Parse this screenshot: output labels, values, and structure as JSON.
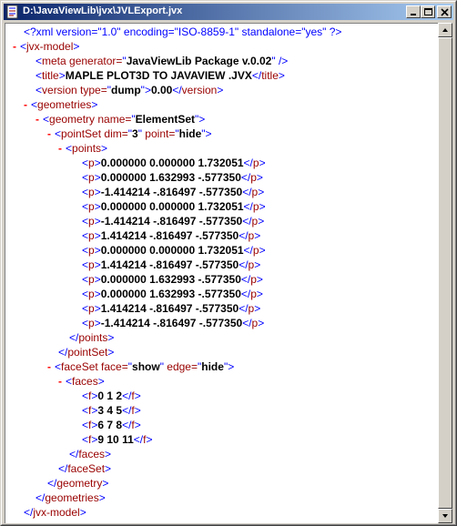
{
  "window": {
    "title": "D:\\JavaViewLib\\jvx\\JVLExport.jvx",
    "icons": {
      "app": "xml-document-icon",
      "minimize": "minimize-icon",
      "maximize": "maximize-icon",
      "close": "close-icon"
    }
  },
  "xml": {
    "declaration": "<?xml version=\"1.0\" encoding=\"ISO-8859-1\" standalone=\"yes\" ?>",
    "toggle": "-",
    "root_open": "jvx-model",
    "root_close": "jvx-model",
    "meta": {
      "tag": "meta",
      "attr": "generator",
      "value": "JavaViewLib Package v.0.02"
    },
    "title": {
      "tag": "title",
      "text": "MAPLE PLOT3D TO JAVAVIEW .JVX"
    },
    "version": {
      "tag": "version",
      "attr": "type",
      "value": "dump",
      "text": "0.00"
    },
    "geometries_tag": "geometries",
    "geometry": {
      "tag": "geometry",
      "attr": "name",
      "value": "ElementSet"
    },
    "pointSet": {
      "tag": "pointSet",
      "attr1": "dim",
      "value1": "3",
      "attr2": "point",
      "value2": "hide"
    },
    "points_tag": "points",
    "point_tag": "p",
    "points": [
      "0.000000 0.000000 1.732051",
      "0.000000 1.632993 -.577350",
      "-1.414214 -.816497 -.577350",
      "0.000000 0.000000 1.732051",
      "-1.414214 -.816497 -.577350",
      "1.414214 -.816497 -.577350",
      "0.000000 0.000000 1.732051",
      "1.414214 -.816497 -.577350",
      "0.000000 1.632993 -.577350",
      "0.000000 1.632993 -.577350",
      "1.414214 -.816497 -.577350",
      "-1.414214 -.816497 -.577350"
    ],
    "faceSet": {
      "tag": "faceSet",
      "attr1": "face",
      "value1": "show",
      "attr2": "edge",
      "value2": "hide"
    },
    "faces_tag": "faces",
    "face_tag": "f",
    "faces": [
      "0 1 2",
      "3 4 5",
      "6 7 8",
      "9 10 11"
    ]
  }
}
